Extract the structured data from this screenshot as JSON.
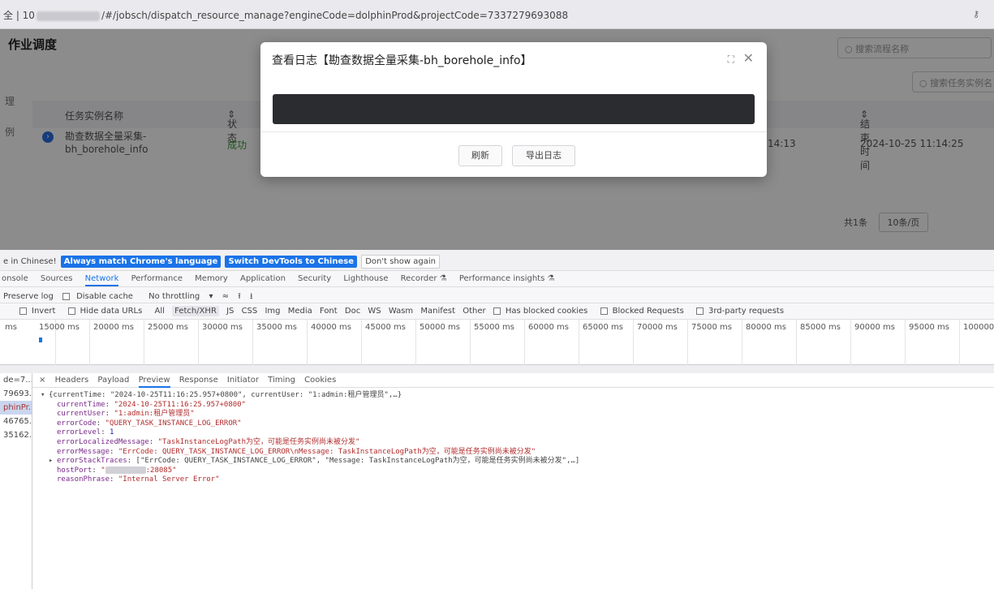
{
  "browser": {
    "url_prefix": "全 | 10",
    "url_suffix": "/#/jobsch/dispatch_resource_manage?engineCode=dolphinProd&projectCode=7337279693088",
    "key_icon": "key-icon"
  },
  "page": {
    "title": "作业调度",
    "search_workflow": "搜索流程名称",
    "search_task": "搜索任务实例名",
    "side_labels": [
      "理",
      "例"
    ],
    "columns": {
      "name": "任务实例名称",
      "status": "状态",
      "end_time": "结束时间"
    },
    "row": {
      "name": "勘查数据全量采集-bh_borehole_info",
      "status": "成功",
      "start_time_fragment": "14:13",
      "end_time": "2024-10-25 11:14:25"
    },
    "pager": {
      "total": "共1条",
      "page_size": "10条/页"
    }
  },
  "modal": {
    "title": "查看日志【勘查数据全量采集-bh_borehole_info】",
    "refresh": "刷新",
    "export": "导出日志"
  },
  "devtools": {
    "infobar": {
      "prefix": "e in Chinese!",
      "btn_match": "Always match Chrome's language",
      "btn_switch": "Switch DevTools to Chinese",
      "btn_dont": "Don't show again"
    },
    "tabs": [
      "onsole",
      "Sources",
      "Network",
      "Performance",
      "Memory",
      "Application",
      "Security",
      "Lighthouse",
      "Recorder ⚗",
      "Performance insights ⚗"
    ],
    "toolbar": {
      "preserve": "Preserve log",
      "disable_cache": "Disable cache",
      "throttle": "No throttling"
    },
    "filters": [
      "Invert",
      "Hide data URLs",
      "All",
      "Fetch/XHR",
      "JS",
      "CSS",
      "Img",
      "Media",
      "Font",
      "Doc",
      "WS",
      "Wasm",
      "Manifest",
      "Other",
      "Has blocked cookies",
      "Blocked Requests",
      "3rd-party requests"
    ],
    "timeline_ticks": [
      "ms",
      "15000 ms",
      "20000 ms",
      "25000 ms",
      "30000 ms",
      "35000 ms",
      "40000 ms",
      "45000 ms",
      "50000 ms",
      "55000 ms",
      "60000 ms",
      "65000 ms",
      "70000 ms",
      "75000 ms",
      "80000 ms",
      "85000 ms",
      "90000 ms",
      "95000 ms",
      "100000"
    ],
    "requests": [
      "de=7...",
      "79693...",
      "phinPr...",
      "46765...",
      "35162..."
    ],
    "detail_tabs": [
      "×",
      "Headers",
      "Payload",
      "Preview",
      "Response",
      "Initiator",
      "Timing",
      "Cookies"
    ],
    "preview": {
      "summary": "{currentTime: \"2024-10-25T11:16:25.957+0800\", currentUser: \"1:admin:租户管理员\",…}",
      "currentTime": "\"2024-10-25T11:16:25.957+0800\"",
      "currentUser": "\"1:admin:租户管理员\"",
      "errorCode": "\"QUERY_TASK_INSTANCE_LOG_ERROR\"",
      "errorLevel": "1",
      "errorLocalizedMessage": "\"TaskInstanceLogPath为空，可能是任务实例尚未被分发\"",
      "errorMessage": "\"ErrCode: QUERY_TASK_INSTANCE_LOG_ERROR\\nMessage: TaskInstanceLogPath为空，可能是任务实例尚未被分发\"",
      "errorStackTraces": "[\"ErrCode: QUERY_TASK_INSTANCE_LOG_ERROR\", \"Message: TaskInstanceLogPath为空，可能是任务实例尚未被分发\",…]",
      "hostPort_suffix": ":28085\"",
      "reasonPhrase": "\"Internal Server Error\""
    }
  }
}
